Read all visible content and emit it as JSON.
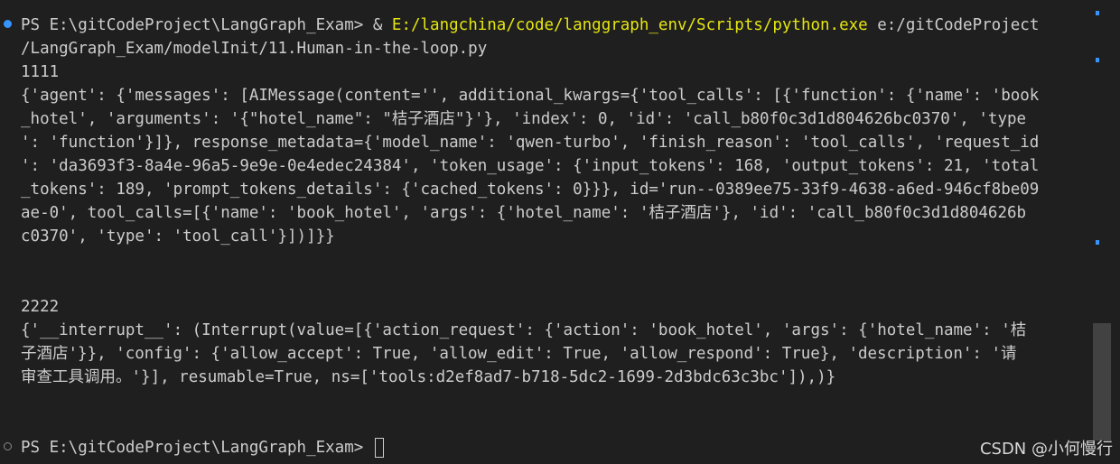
{
  "terminal": {
    "command_prompt": "PS E:\\gitCodeProject\\LangGraph_Exam> ",
    "command_amp": "& ",
    "command_exe": "E:/langchina/code/langgraph_env/Scripts/python.exe",
    "command_arg_1": " e:/gitCodeProject",
    "command_arg_2": "/LangGraph_Exam/modelInit/11.Human-in-the-loop.py",
    "output_lines": [
      "1111",
      "{'agent': {'messages': [AIMessage(content='', additional_kwargs={'tool_calls': [{'function': {'name': 'book",
      "_hotel', 'arguments': '{\"hotel_name\": \"桔子酒店\"}'}, 'index': 0, 'id': 'call_b80f0c3d1d804626bc0370', 'type",
      "': 'function'}]}, response_metadata={'model_name': 'qwen-turbo', 'finish_reason': 'tool_calls', 'request_id",
      "': 'da3693f3-8a4e-96a5-9e9e-0e4edec24384', 'token_usage': {'input_tokens': 168, 'output_tokens': 21, 'total",
      "_tokens': 189, 'prompt_tokens_details': {'cached_tokens': 0}}}, id='run--0389ee75-33f9-4638-a6ed-946cf8be09",
      "ae-0', tool_calls=[{'name': 'book_hotel', 'args': {'hotel_name': '桔子酒店'}, 'id': 'call_b80f0c3d1d804626b",
      "c0370', 'type': 'tool_call'}])]}}",
      "",
      "",
      "2222",
      "{'__interrupt__': (Interrupt(value=[{'action_request': {'action': 'book_hotel', 'args': {'hotel_name': '桔",
      "子酒店'}}, 'config': {'allow_accept': True, 'allow_edit': True, 'allow_respond': True}, 'description': '请",
      "审查工具调用。'}], resumable=True, ns=['tools:d2ef8ad7-b718-5dc2-1699-2d3bdc63c3bc']),)}"
    ],
    "final_prompt": "PS E:\\gitCodeProject\\LangGraph_Exam> "
  },
  "watermark": "CSDN @小何慢行",
  "colors": {
    "background": "#1f1f1f",
    "text": "#cccccc",
    "executable": "#e5e510",
    "accent": "#3794ff"
  }
}
